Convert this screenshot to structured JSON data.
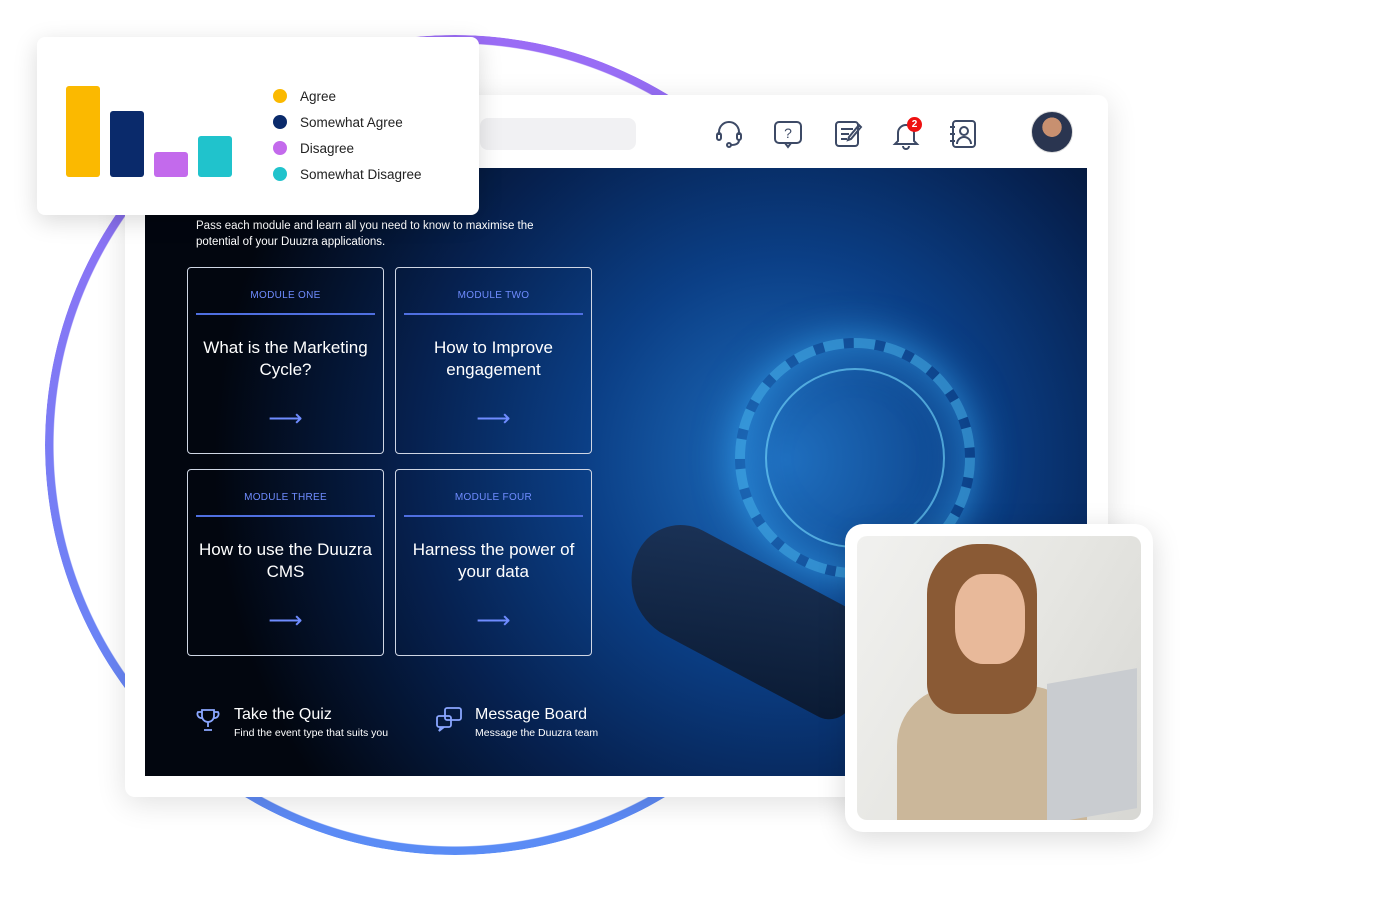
{
  "chart_data": {
    "type": "bar",
    "categories": [
      "Agree",
      "Somewhat Agree",
      "Disagree",
      "Somewhat Disagree"
    ],
    "values": [
      91,
      66,
      25,
      41
    ],
    "colors": [
      "#fbb900",
      "#0a2a6b",
      "#c36aec",
      "#20c3cc"
    ],
    "legend": "right",
    "axes": false,
    "series": [
      {
        "values": [
          91,
          66,
          25,
          41
        ]
      }
    ]
  },
  "header": {
    "icons": [
      "headset-icon",
      "help-icon",
      "notes-icon",
      "bell-icon",
      "contacts-icon"
    ],
    "notification_count": "2"
  },
  "intro": "Pass each module and learn all you need to know to maximise the potential of your Duuzra applications.",
  "modules": [
    {
      "label": "MODULE ONE",
      "title": "What is the Marketing Cycle?"
    },
    {
      "label": "MODULE TWO",
      "title": "How to Improve engagement"
    },
    {
      "label": "MODULE THREE",
      "title": "How to use the Duuzra CMS"
    },
    {
      "label": "MODULE FOUR",
      "title": "Harness the power of your data"
    }
  ],
  "links": [
    {
      "title": "Take the Quiz",
      "subtitle": "Find the event type that suits you"
    },
    {
      "title": "Message Board",
      "subtitle": "Message the Duuzra team"
    }
  ]
}
